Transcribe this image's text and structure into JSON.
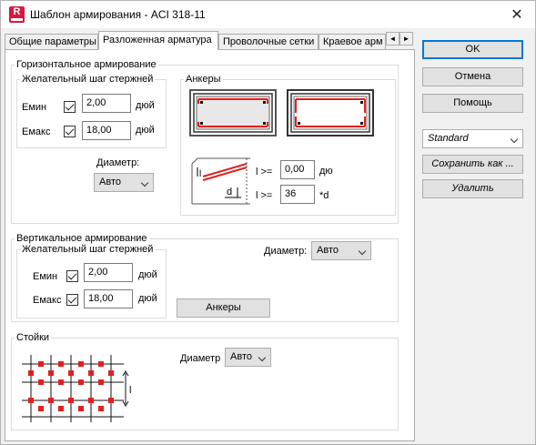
{
  "window": {
    "title": "Шаблон армирования - ACI 318-11",
    "app_icon_letter": "R",
    "close_glyph": "✕"
  },
  "tabs": [
    {
      "label": "Общие параметры"
    },
    {
      "label": "Разложенная арматура"
    },
    {
      "label": "Проволочные сетки"
    },
    {
      "label": "Краевое арм"
    }
  ],
  "tab_arrows": {
    "left": "◄",
    "right": "►"
  },
  "horizontal": {
    "group_label": "Горизонтальное армирование",
    "spacing_label": "Желательный шаг стержней",
    "emin_label": "Емин",
    "emin_value": "2,00",
    "emin_unit": "дюй",
    "emax_label": "Емакс",
    "emax_value": "18,00",
    "emax_unit": "дюй",
    "diameter_label": "Диаметр:",
    "diameter_value": "Авто"
  },
  "anchors": {
    "group_label": "Анкеры",
    "l_label_1": "l >=",
    "l_value_1": "0,00",
    "l_unit_1": "дю",
    "l_label_2": "l >=",
    "l_value_2": "36",
    "l_unit_2": "*d",
    "diagram_l": "l",
    "diagram_d": "d"
  },
  "vertical": {
    "group_label": "Вертикальное армирование",
    "spacing_label": "Желательный шаг стержней",
    "emin_label": "Емин",
    "emin_value": "2,00",
    "emin_unit": "дюй",
    "emax_label": "Емакс",
    "emax_value": "18,00",
    "emax_unit": "дюй",
    "diameter_label": "Диаметр:",
    "diameter_value": "Авто",
    "anchors_button": "Анкеры"
  },
  "stirrups": {
    "group_label": "Стойки",
    "diameter_label": "Диаметр",
    "diameter_value": "Авто",
    "diagram_l": "l"
  },
  "right": {
    "ok": "OK",
    "cancel": "Отмена",
    "help": "Помощь",
    "template_value": "Standard",
    "save_as": "Сохранить как ...",
    "delete": "Удалить"
  },
  "colors": {
    "accent": "#0078d7",
    "rebar": "#e02020"
  }
}
